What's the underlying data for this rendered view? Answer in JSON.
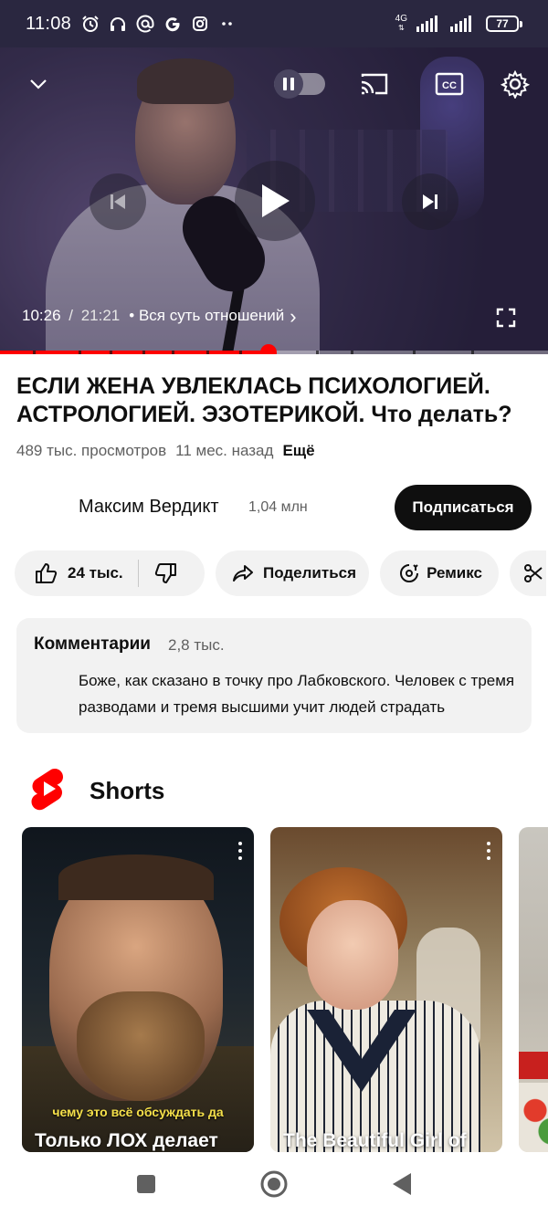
{
  "status_bar": {
    "time": "11:08",
    "notification_icons": [
      "alarm-icon",
      "headphones-icon",
      "at-icon",
      "google-icon",
      "instagram-icon",
      "more-dots-icon"
    ],
    "network": "4G",
    "battery": "77"
  },
  "player": {
    "current_time": "10:26",
    "separator": " / ",
    "duration": "21:21",
    "chapter": "• Вся суть отношений",
    "chapter_chevron": "›",
    "progress_fraction": 0.49,
    "played_color": "#ff0000"
  },
  "video": {
    "title": "ЕСЛИ ЖЕНА УВЛЕКЛАСЬ ПСИХОЛОГИЕЙ. АСТРОЛОГИЕЙ. ЭЗОТЕРИКОЙ. Что делать?",
    "views": "489 тыс. просмотров",
    "age": "11 мес. назад",
    "more_label": "Ещё"
  },
  "channel": {
    "name": "Максим Вердикт",
    "subscribers": "1,04 млн",
    "subscribe_label": "Подписаться"
  },
  "actions": {
    "likes": "24 тыс.",
    "share_label": "Поделиться",
    "remix_label": "Ремикс"
  },
  "comments": {
    "header": "Комментарии",
    "count": "2,8 тыс.",
    "top_comment": "Боже, как сказано в точку про Лабковского. Человек с тремя разводами и тремя высшими учит людей страдать"
  },
  "shorts": {
    "header": "Shorts",
    "brand_color": "#ff0000",
    "items": [
      {
        "caption": "Только ЛОХ делает",
        "subtitle": "чему это всё обсуждать да"
      },
      {
        "caption": "The Beautiful Girl of"
      }
    ]
  },
  "nav": {
    "buttons": [
      "recents-square-icon",
      "home-circle-icon",
      "back-triangle-icon"
    ]
  }
}
